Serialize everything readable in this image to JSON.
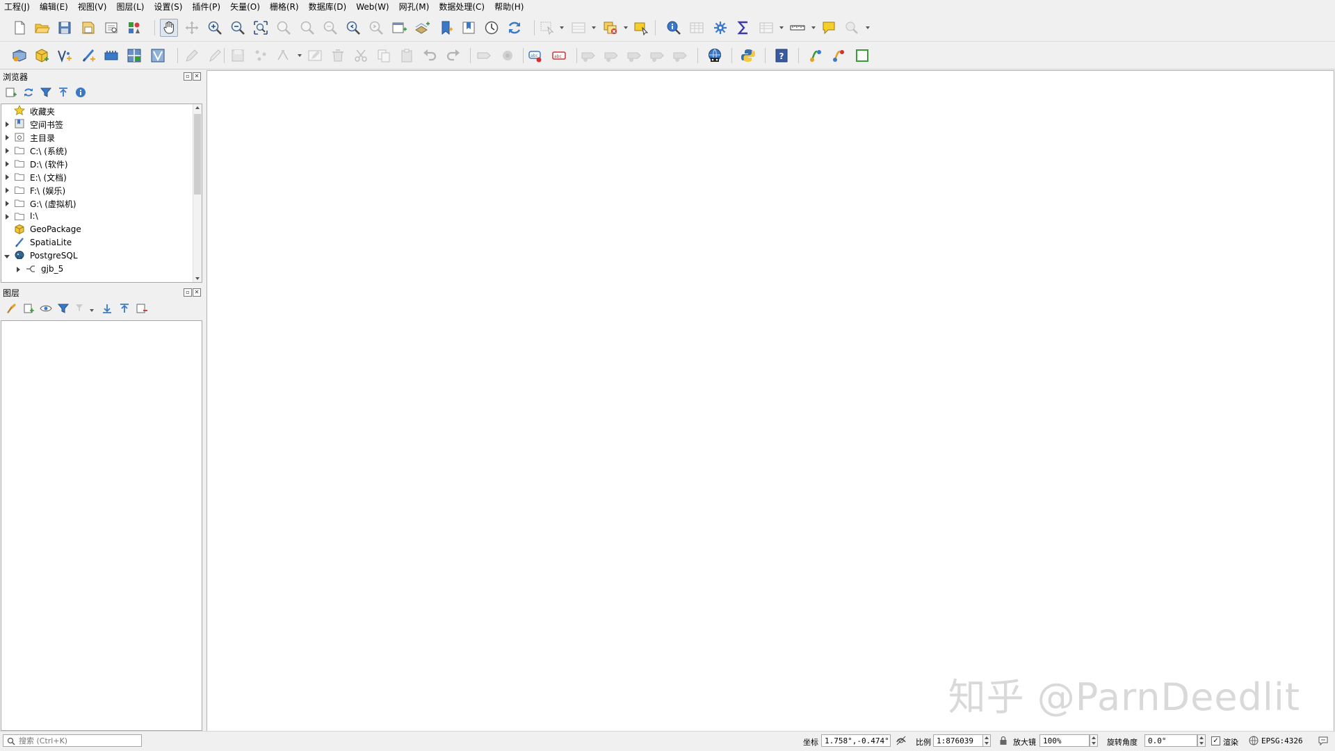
{
  "menubar": {
    "items": [
      "工程(J)",
      "编辑(E)",
      "视图(V)",
      "图层(L)",
      "设置(S)",
      "插件(P)",
      "矢量(O)",
      "栅格(R)",
      "数据库(D)",
      "Web(W)",
      "网孔(M)",
      "数据处理(C)",
      "帮助(H)"
    ]
  },
  "toolbar1": {
    "icons": [
      "new-project-icon",
      "open-project-icon",
      "save-project-icon",
      "save-as-icon",
      "print-layout-icon",
      "style-manager-icon",
      "pan-icon",
      "pan-to-selection-icon",
      "zoom-in-icon",
      "zoom-out-icon",
      "zoom-full-icon",
      "zoom-to-selection-icon",
      "zoom-to-layer-icon",
      "zoom-native-icon",
      "zoom-last-icon",
      "zoom-next-icon",
      "new-map-view-icon",
      "new-3d-view-icon",
      "new-bookmark-icon",
      "show-bookmarks-icon",
      "temporal-controller-icon",
      "refresh-icon",
      "select-features-icon",
      "select-by-value-icon",
      "deselect-icon",
      "select-by-location-icon",
      "identify-icon",
      "attribute-table-icon",
      "processing-toolbox-icon",
      "statistics-icon",
      "open-field-calculator-icon",
      "measure-icon",
      "map-tips-icon",
      "locator-icon"
    ]
  },
  "toolbar2": {
    "icons": [
      "data-source-manager-icon",
      "new-geopackage-layer-icon",
      "new-shapefile-layer-icon",
      "new-spatialite-layer-icon",
      "new-temporary-layer-icon",
      "new-virtual-layer-icon",
      "new-vector-layer-icon",
      "toggle-editing-icon",
      "current-edits-icon",
      "save-edits-icon",
      "add-feature-icon",
      "vertex-tool-icon",
      "modify-attributes-icon",
      "delete-selected-icon",
      "cut-features-icon",
      "copy-features-icon",
      "paste-features-icon",
      "undo-icon",
      "redo-icon",
      "label-icon",
      "label-pin-icon",
      "diagram-icon",
      "highlight-label-icon",
      "label-tool-1-icon",
      "label-tool-2-icon",
      "label-tool-3-icon",
      "label-tool-4-icon",
      "label-tool-5-icon",
      "web-service-icon",
      "python-console-icon",
      "help-icon",
      "plugin-1-icon",
      "plugin-2-icon",
      "plugin-3-icon"
    ]
  },
  "browser_panel": {
    "title": "浏览器",
    "items": [
      {
        "label": "收藏夹",
        "icon": "favorites-star-icon",
        "expandable": false,
        "open": false,
        "indent": 0
      },
      {
        "label": "空间书签",
        "icon": "spatial-bookmarks-icon",
        "expandable": true,
        "open": false,
        "indent": 0
      },
      {
        "label": "主目录",
        "icon": "home-folder-icon",
        "expandable": true,
        "open": false,
        "indent": 0
      },
      {
        "label": "C:\\ (系统)",
        "icon": "folder-icon",
        "expandable": true,
        "open": false,
        "indent": 0
      },
      {
        "label": "D:\\ (软件)",
        "icon": "folder-icon",
        "expandable": true,
        "open": false,
        "indent": 0
      },
      {
        "label": "E:\\ (文档)",
        "icon": "folder-icon",
        "expandable": true,
        "open": false,
        "indent": 0
      },
      {
        "label": "F:\\ (娱乐)",
        "icon": "folder-icon",
        "expandable": true,
        "open": false,
        "indent": 0
      },
      {
        "label": "G:\\ (虚拟机)",
        "icon": "folder-icon",
        "expandable": true,
        "open": false,
        "indent": 0
      },
      {
        "label": "I:\\",
        "icon": "folder-icon",
        "expandable": true,
        "open": false,
        "indent": 0
      },
      {
        "label": "GeoPackage",
        "icon": "geopackage-icon",
        "expandable": false,
        "open": false,
        "indent": 0
      },
      {
        "label": "SpatiaLite",
        "icon": "spatialite-icon",
        "expandable": false,
        "open": false,
        "indent": 0
      },
      {
        "label": "PostgreSQL",
        "icon": "postgresql-icon",
        "expandable": true,
        "open": true,
        "indent": 0
      },
      {
        "label": "gjb_5",
        "icon": "db-connection-icon",
        "expandable": true,
        "open": false,
        "indent": 1
      }
    ]
  },
  "layers_panel": {
    "title": "图层"
  },
  "watermark": "知乎 @ParnDeedlit",
  "statusbar": {
    "search_placeholder": "搜索 (Ctrl+K)",
    "coordinate_label": "坐标",
    "coordinate_value": "1.758°,-0.474°",
    "scale_label": "比例",
    "scale_value": "1:876039",
    "magnifier_label": "放大镜",
    "magnifier_value": "100%",
    "rotation_label": "旋转角度",
    "rotation_value": "0.0°",
    "render_label": "渲染",
    "crs_value": "EPSG:4326"
  },
  "colors": {
    "accent_blue": "#3a78c8",
    "folder_gray": "#8a8a8a",
    "postgres_blue": "#336791"
  }
}
